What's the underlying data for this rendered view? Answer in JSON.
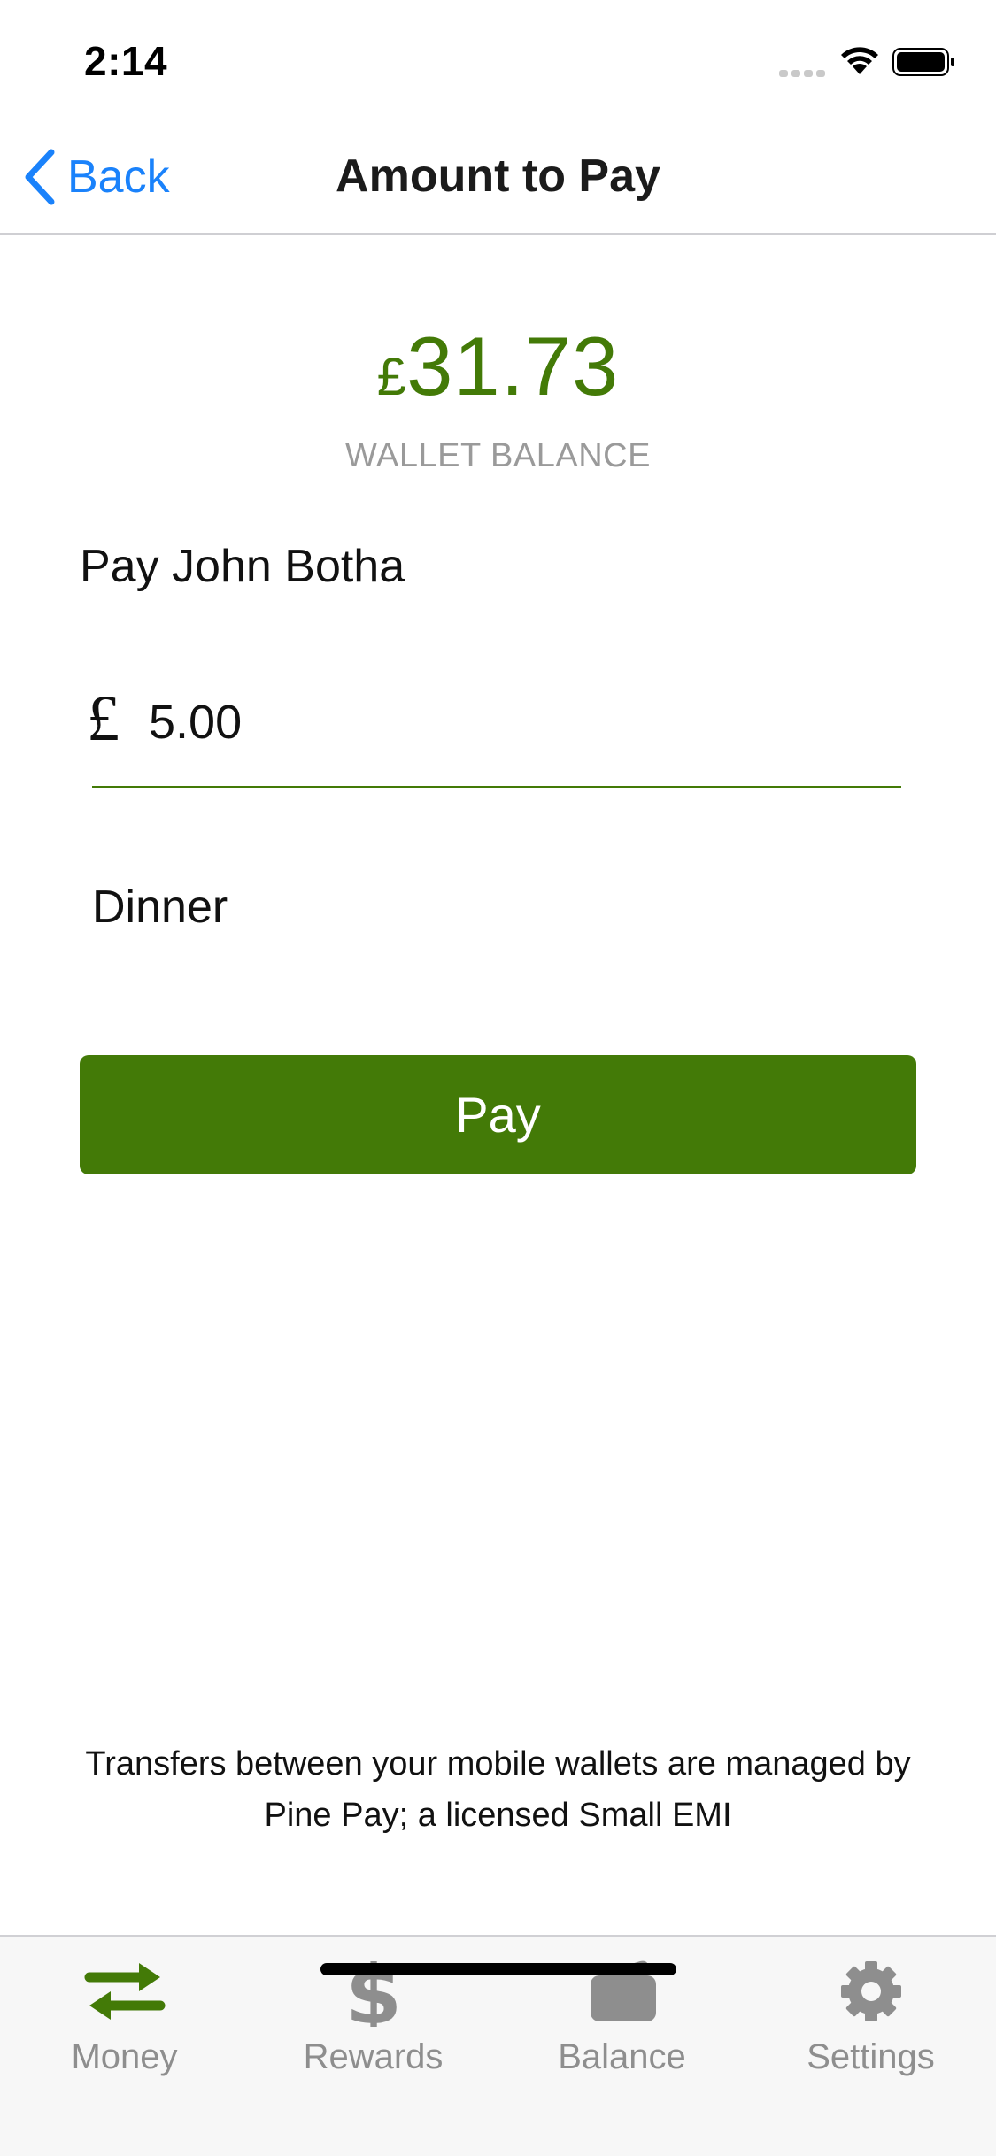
{
  "status_bar": {
    "time": "2:14",
    "icons": [
      "cellular-signal-icon",
      "wifi-icon",
      "battery-icon"
    ]
  },
  "nav": {
    "back_label": "Back",
    "title": "Amount to Pay"
  },
  "balance": {
    "currency": "£",
    "amount": "31.73",
    "label": "WALLET BALANCE"
  },
  "payee": "Pay John Botha",
  "amount_field": {
    "currency": "£",
    "value": "5.00"
  },
  "note_field": {
    "value": "Dinner"
  },
  "pay_button": {
    "label": "Pay"
  },
  "disclaimer": {
    "line1": "Transfers between your mobile wallets are managed by",
    "line2": "Pine Pay; a licensed Small EMI"
  },
  "tabs": [
    {
      "label": "Money",
      "icon": "transfer-arrows-icon",
      "active": true
    },
    {
      "label": "Rewards",
      "icon": "dollar-icon",
      "active": false
    },
    {
      "label": "Balance",
      "icon": "wallet-icon",
      "active": false
    },
    {
      "label": "Settings",
      "icon": "gear-icon",
      "active": false
    }
  ],
  "colors": {
    "brand_green": "#437a07",
    "link_blue": "#1a82fb",
    "muted_gray": "#8e8e8e"
  }
}
